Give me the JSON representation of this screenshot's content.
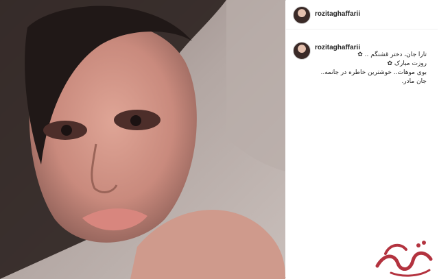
{
  "post": {
    "username": "rozitaghaffarii",
    "caption_lines": [
      "تارا جان، دختر قشنگم .. ✿",
      "روزت مبارک ✿",
      "بوی موهات.. خوشترین خاطره در جانمه..",
      "جان مادر."
    ]
  },
  "colors": {
    "border": "#dbdbdb",
    "text": "#262626",
    "flower": "#e05a9a",
    "watermark": "#b3333f"
  },
  "icons": {
    "avatar": "profile-avatar",
    "watermark": "site-logo-watermark"
  }
}
